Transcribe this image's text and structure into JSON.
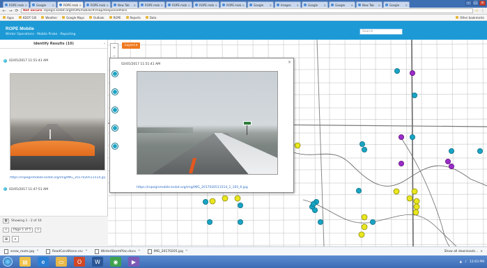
{
  "browser": {
    "tabs": [
      {
        "label": "ROPE mobile"
      },
      {
        "label": "Google"
      },
      {
        "label": "ROPE mobile"
      },
      {
        "label": "ROPE mobile"
      },
      {
        "label": "New Tab"
      },
      {
        "label": "ROPE mobile"
      },
      {
        "label": "ROPE mobile"
      },
      {
        "label": "ROPE mobile"
      },
      {
        "label": "ROPE mobile"
      },
      {
        "label": "Google"
      },
      {
        "label": "Images"
      },
      {
        "label": "Google"
      },
      {
        "label": "Google"
      },
      {
        "label": "New Tab"
      },
      {
        "label": "Google"
      }
    ],
    "url_secure": "Not secure",
    "url": "ropegis.ksdot.org/ROPEmobile/#/map/ResponsePlans",
    "bookmarks": [
      {
        "label": "Apps"
      },
      {
        "label": "KDOT GIS"
      },
      {
        "label": "Weather"
      },
      {
        "label": "Google Maps"
      },
      {
        "label": "Outlook"
      },
      {
        "label": "ROPE"
      },
      {
        "label": "Reports"
      },
      {
        "label": "Data"
      }
    ],
    "bookmarks_other": "Other bookmarks",
    "icons": {
      "back": "back-arrow-icon",
      "forward": "forward-arrow-icon",
      "reload": "reload-icon"
    }
  },
  "app": {
    "title": "ROPE Mobile",
    "subtitle": "Winter Operations · Mobile Probe · Reporting",
    "search_placeholder": "Search"
  },
  "left_panel": {
    "header": "Identify Results (10)",
    "post1_time": "02/05/2017 11:51:41 AM",
    "post1_link": "https://ropegismobile.ksdot.org/img/IMG_2017020511514.jpg",
    "post2_time": "02/05/2017 11:47:51 AM",
    "paging_text": "Showing 1 - 2 of 10",
    "page_label": "Page 1 of 5",
    "prev": "<",
    "next": ">"
  },
  "map": {
    "layer_button": "Layers",
    "popup_time": "02/05/2017 11:51:41 AM",
    "popup_link": "https://ropegismobile.ksdot.org/img/IMG_2017020511514_1_105_6.jpg"
  },
  "downloads": [
    {
      "label": "snow_route.jpg"
    },
    {
      "label": "RoadConditions.csv"
    },
    {
      "label": "WinterStormPlan.docx"
    },
    {
      "label": "IMG_20170205.jpg"
    }
  ],
  "downloads_all": "Show all downloads...",
  "taskbar": {
    "clock": "12:03 PM",
    "apps": [
      "explorer",
      "ie",
      "folder",
      "office",
      "word",
      "chrome",
      "media"
    ]
  },
  "colors": {
    "header": "#1d9ad6",
    "accent": "#ef7a1f",
    "link": "#2b6cc4"
  }
}
